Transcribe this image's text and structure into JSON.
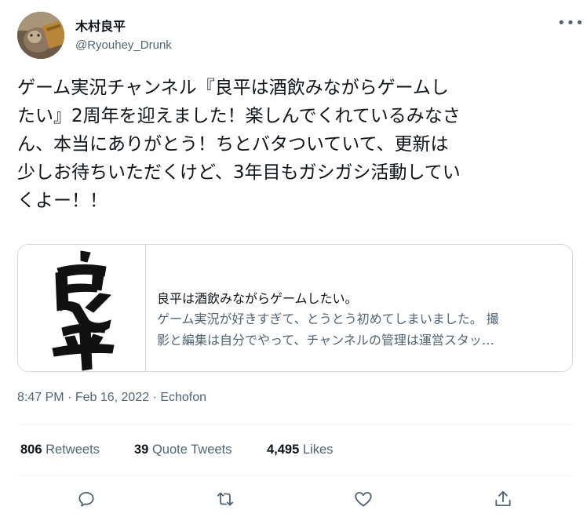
{
  "tweet": {
    "author": {
      "display_name": "木村良平",
      "handle": "@Ryouhey_Drunk"
    },
    "more_icon": "more-horizontal-icon",
    "text": "ゲーム実況チャンネル『良平は酒飲みながらゲームし\nたい』2周年を迎えました！楽しんでくれているみなさ\nん、本当にありがとう！ちとバタついていて、更新は\n少しお待ちいただくけど、3年目もガシガシ活動してい\nくよー！！",
    "card": {
      "title": "良平は酒飲みながらゲームしたい。",
      "description": "ゲーム実況が好きすぎて、とうとう初めてしまいました。 撮\n影と編集は自分でやって、チャンネルの管理は運営スタッ…",
      "thumbnail_text": "良平"
    },
    "meta": {
      "time": "8:47 PM",
      "separator1": " · ",
      "date": "Feb 16, 2022",
      "separator2": " · ",
      "source": "Echofon"
    },
    "stats": {
      "retweets_count": "806",
      "retweets_label": "Retweets",
      "quotes_count": "39",
      "quotes_label": "Quote Tweets",
      "likes_count": "4,495",
      "likes_label": "Likes"
    },
    "actions": [
      "reply-icon",
      "retweet-icon",
      "like-icon",
      "share-icon"
    ],
    "colors": {
      "text_primary": "#0f1419",
      "text_secondary": "#536471",
      "border": "#cfd9de"
    }
  }
}
